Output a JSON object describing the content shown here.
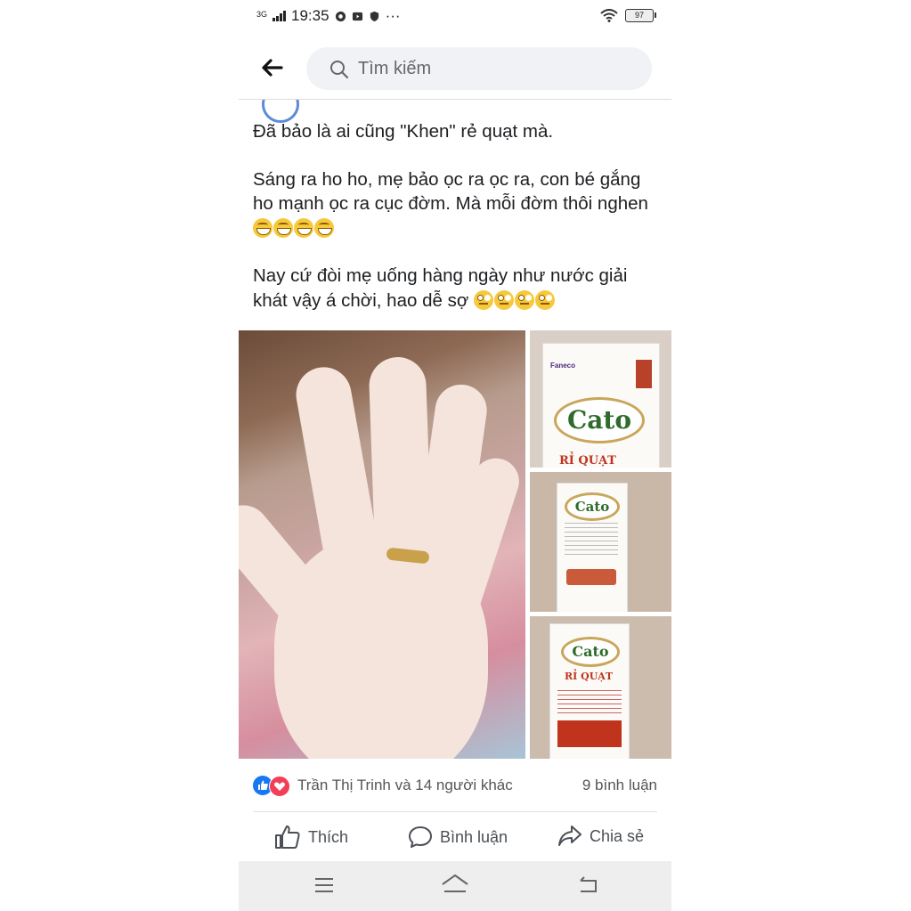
{
  "status_bar": {
    "network": "3G",
    "time": "19:35",
    "more": "···",
    "battery": "97"
  },
  "header": {
    "search_placeholder": "Tìm kiếm"
  },
  "post": {
    "paragraphs": [
      "Đã bảo là ai cũng \"Khen\" rẻ quạt mà.",
      "Sáng ra ho ho, mẹ bảo ọc ra ọc ra, con bé gắng ho mạnh ọc ra cục đờm. Mà mỗi đờm thôi nghen",
      "Nay cứ đòi mẹ uống hàng ngày như nước giải khát vậy á chời, hao dễ sợ"
    ],
    "emoji_2": "grin-icon x4",
    "emoji_3": "rolling-eyes-icon x4"
  },
  "photos": {
    "brand_top": "Faneco",
    "brand_name": "Cato",
    "product_line": "RỈ QUẠT"
  },
  "reactions": {
    "names": "Trần Thị Trinh và 14 người khác",
    "comments": "9 bình luận"
  },
  "actions": {
    "like": "Thích",
    "comment": "Bình luận",
    "share": "Chia sẻ"
  },
  "colors": {
    "like_blue": "#1877f2",
    "love_red": "#f33e58",
    "text": "#1c1e21",
    "muted": "#65676b"
  }
}
